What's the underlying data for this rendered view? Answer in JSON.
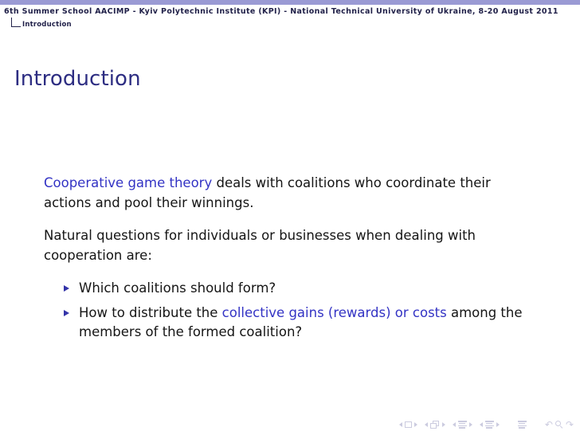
{
  "theme": {
    "topbar_color": "#9a9ad4",
    "title_color": "#2d2d82",
    "accent_color": "#3333c4",
    "text_color": "#151515",
    "nav_symbol_color": "#c9c9de"
  },
  "header": {
    "conference_title": "6th Summer School AACIMP - Kyiv Polytechnic Institute (KPI) - National Technical University of Ukraine, 8-20 August 2011",
    "nav_section": "Introduction"
  },
  "slide": {
    "title": "Introduction",
    "paragraphs": [
      {
        "segments": [
          {
            "text": "Cooperative game theory",
            "style": "accent"
          },
          {
            "text": " deals with coalitions who coordinate their actions and pool their winnings.",
            "style": "normal"
          }
        ]
      },
      {
        "segments": [
          {
            "text": "Natural questions for individuals or businesses when dealing with cooperation are:",
            "style": "normal"
          }
        ]
      }
    ],
    "bullets": [
      {
        "marker": "triangle-right-icon",
        "segments": [
          {
            "text": "Which coalitions should form?",
            "style": "normal"
          }
        ]
      },
      {
        "marker": "triangle-right-icon",
        "segments": [
          {
            "text": "How to distribute the ",
            "style": "normal"
          },
          {
            "text": "collective gains (rewards) or costs",
            "style": "accent"
          },
          {
            "text": " among the members of the formed coalition?",
            "style": "normal"
          }
        ]
      }
    ]
  },
  "navigation_symbols": {
    "groups": [
      {
        "name": "slide-navigation",
        "prev": "triangle-left-icon",
        "icon": "slide-square-icon",
        "next": "triangle-right-icon"
      },
      {
        "name": "frame-navigation",
        "prev": "triangle-left-icon",
        "icon": "frame-stack-icon",
        "next": "triangle-right-icon"
      },
      {
        "name": "subsection-navigation",
        "prev": "triangle-left-icon",
        "icon": "subsection-lines-icon",
        "next": "triangle-right-icon"
      },
      {
        "name": "section-navigation",
        "prev": "triangle-left-icon",
        "icon": "section-lines-icon",
        "next": "triangle-right-icon"
      }
    ],
    "document_icon": "document-lines-icon",
    "back_icon": "go-back-icon",
    "search_icon": "search-icon",
    "forward_icon": "go-forward-icon",
    "back_glyph": "↶",
    "forward_glyph": "↷"
  }
}
